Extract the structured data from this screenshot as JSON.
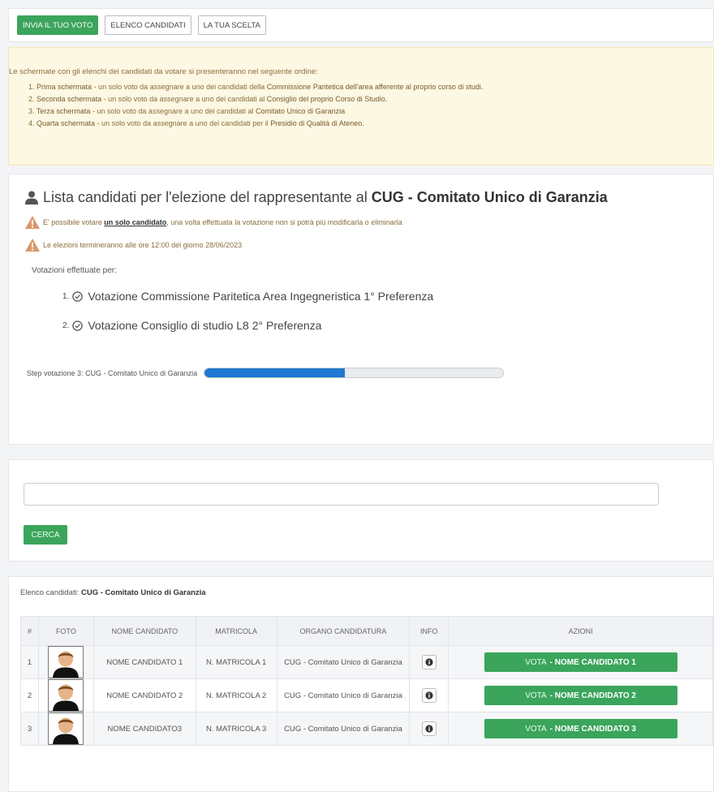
{
  "nav": {
    "vote_label": "INVIA IL TUO VOTO",
    "candidates_label": "ELENCO CANDIDATI",
    "choice_label": "LA TUA SCELTA"
  },
  "notice": {
    "intro": "Le schermate con gli elenchi dei candidati da votare si presenteranno nel seguente ordine:",
    "items": [
      {
        "n": "1.",
        "head": "Prima schermata",
        "text": " - un solo voto da assegnare a uno dei candidati della ",
        "org": "Commissione Paritetica dell'area afferente al proprio corso di studi."
      },
      {
        "n": "2.",
        "head": "Seconda schermata",
        "text": " - un solo voto da assegnare a uno dei candidati al ",
        "org": "Consiglio del proprio Corso di Studio."
      },
      {
        "n": "3.",
        "head": "Terza schermata",
        "text": " - un solo voto da assegnare a uno dei candidati al ",
        "org": "Comitato Unico di Garanzia"
      },
      {
        "n": "4.",
        "head": "Quarta schermata",
        "text": " - un solo voto da assegnare a uno dei candidati per il ",
        "org": "Presidio di Qualità di Ateneo."
      }
    ]
  },
  "election": {
    "title_prefix": "Lista candidati per l'elezione del rappresentante al",
    "title_org": "CUG - Comitato Unico di Garanzia",
    "warn1_a": "E' possibile votare",
    "warn1_link": "un solo candidato",
    "warn1_b": ", una volta effettuata la votazione non si potrà più modificarla o eliminarla",
    "warn2": "Le elezioni termineranno alle ore 12:00 del giorno 28/06/2023",
    "votes_label": "Votazioni effettuate per:",
    "votes": [
      {
        "num": "1.",
        "text": "Votazione Commissione Paritetica Area Ingegneristica 1° Preferenza"
      },
      {
        "num": "2.",
        "text": "Votazione Consiglio di studio L8 2° Preferenza"
      }
    ],
    "step_label": "Step votazione 3: CUG - Comitato Unico di Garanzia",
    "progress_fraction": 0.47,
    "progress_color": "#1f78d1"
  },
  "search": {
    "placeholder": "",
    "button_label": "CERCA"
  },
  "candidates": {
    "list_label": "Elenco candidati:",
    "list_org": "CUG - Comitato Unico di Garanzia",
    "headers": [
      "#",
      "FOTO",
      "NOME CANDIDATO",
      "MATRICOLA",
      "ORGANO CANDIDATURA",
      "INFO",
      "AZIONI"
    ],
    "rows": [
      {
        "idx": "1",
        "name": "NOME CANDIDATO 1",
        "matricola": "N. MATRICOLA 1",
        "organo": "CUG - Comitato Unico di Garanzia",
        "vote_prefix": "VOTA",
        "vote_name": "- NOME CANDIDATO 1"
      },
      {
        "idx": "2",
        "name": "NOME CANDIDATO 2",
        "matricola": "N. MATRICOLA 2",
        "organo": "CUG - Comitato Unico di Garanzia",
        "vote_prefix": "VOTA",
        "vote_name": "- NOME CANDIDATO 2"
      },
      {
        "idx": "3",
        "name": "NOME CANDIDATO3",
        "matricola": "N. MATRICOLA 3",
        "organo": "CUG - Comitato Unico di Garanzia",
        "vote_prefix": "VOTA",
        "vote_name": "- NOME CANDIDATO 3"
      }
    ]
  },
  "colors": {
    "accent_green": "#3ba55c",
    "warning_bg": "#fcf8e3",
    "warning_icon": "#d9986b"
  }
}
